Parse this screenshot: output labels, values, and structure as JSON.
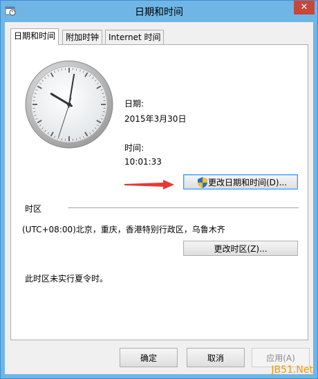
{
  "window": {
    "title": "日期和时间",
    "close_label": "✕"
  },
  "tabs": [
    {
      "label": "日期和时间",
      "active": true
    },
    {
      "label": "附加时钟",
      "active": false
    },
    {
      "label": "Internet 时间",
      "active": false
    }
  ],
  "datetime": {
    "date_label": "日期:",
    "date_value": "2015年3月30日",
    "time_label": "时间:",
    "time_value": "10:01:33",
    "change_button": "更改日期和时间(D)..."
  },
  "clock": {
    "hour": 10,
    "minute": 1,
    "second": 33
  },
  "timezone": {
    "section_label": "时区",
    "value": "(UTC+08:00)北京，重庆，香港特别行政区，乌鲁木齐",
    "change_button": "更改时区(Z)...",
    "dst_note": "此时区未实行夏令时。"
  },
  "footer": {
    "ok": "确定",
    "cancel": "取消",
    "apply": "应用(A)"
  },
  "watermark": "JB51.Net",
  "colors": {
    "frame": "#6fb6e6",
    "close": "#c7473a",
    "arrow": "#e53935",
    "watermark": "#f39800"
  }
}
